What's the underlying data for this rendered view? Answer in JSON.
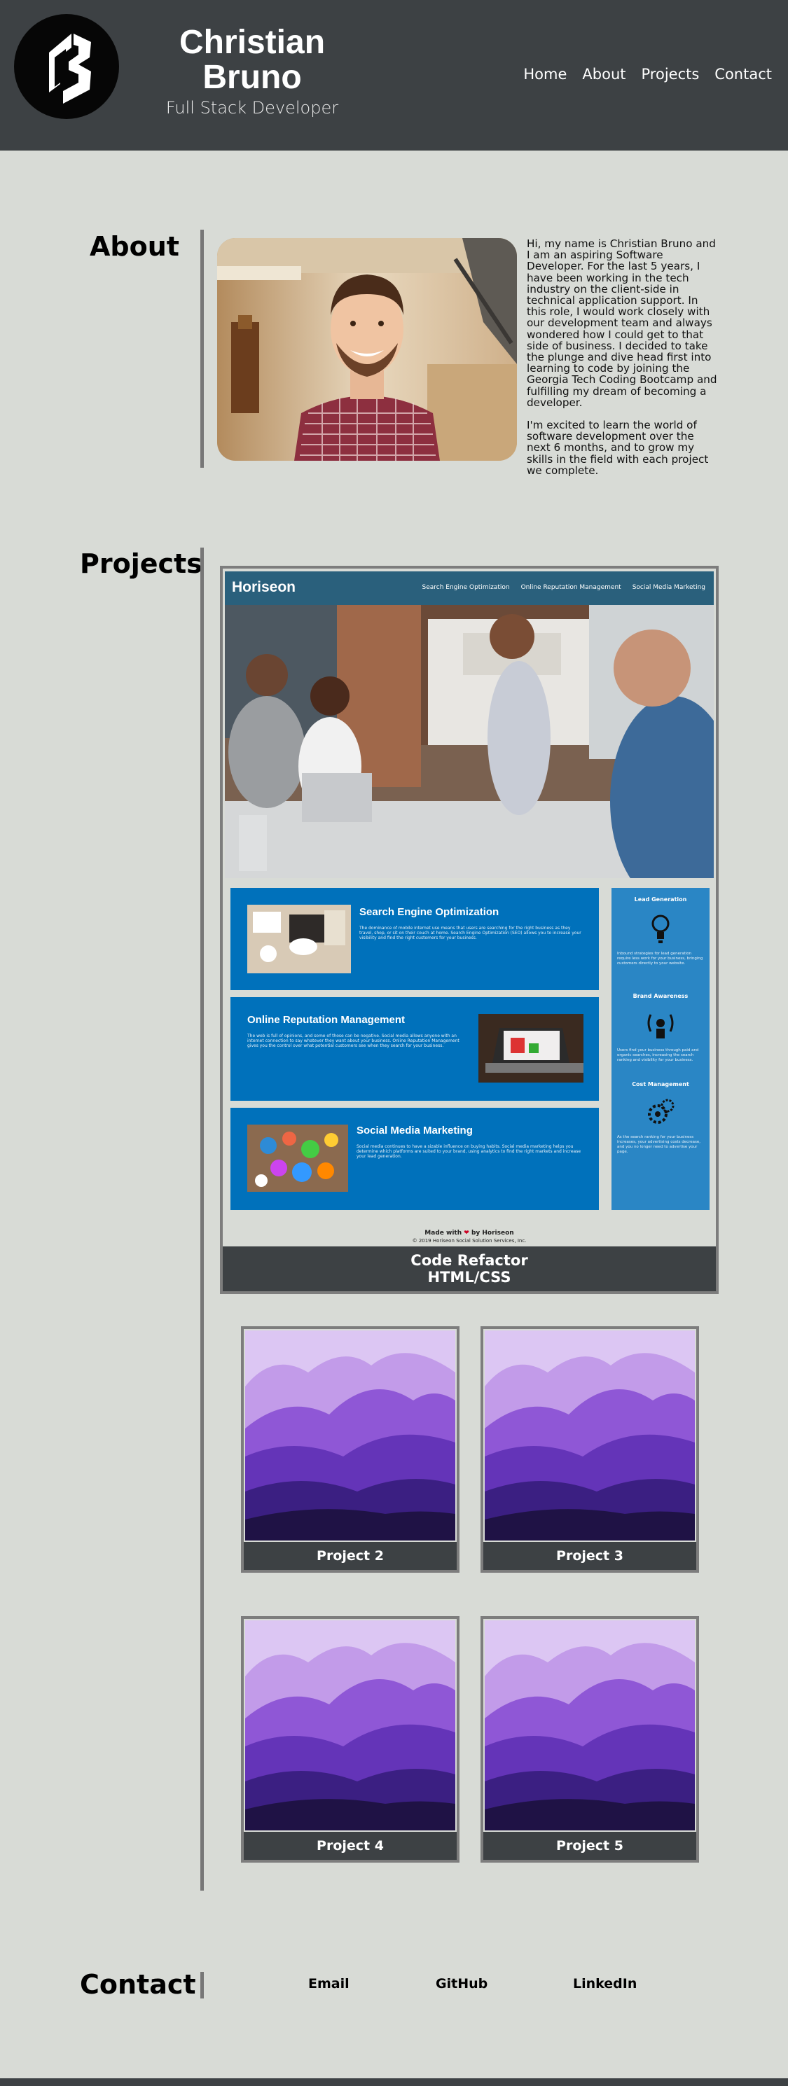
{
  "header": {
    "name_first": "Christian",
    "name_last": "Bruno",
    "subtitle": "Full Stack Developer",
    "nav": [
      "Home",
      "About",
      "Projects",
      "Contact"
    ]
  },
  "about": {
    "title": "About",
    "paragraph1": "Hi, my name is Christian Bruno and I am an aspiring Software Developer. For the last 5 years, I have been working in the tech industry on the client-side in technical application support. In this role, I would work closely with our development team and always wondered how I could get to that side of business. I decided to take the plunge and dive head first into learning to code by joining the Georgia Tech Coding Bootcamp and fulfilling my dream of becoming a developer.",
    "paragraph2": "I'm excited to learn the world of software development over the next 6 months, and to grow my skills in the field with each project we complete."
  },
  "projects": {
    "title": "Projects",
    "featured": {
      "caption_line1": "Code Refactor",
      "caption_line2": "HTML/CSS",
      "preview": {
        "logo": "Horiseon",
        "nav": [
          "Search Engine Optimization",
          "Online Reputation Management",
          "Social Media Marketing"
        ],
        "cards": [
          {
            "title": "Search Engine Optimization",
            "text": "The dominance of mobile internet use means that users are searching for the right business as they travel, shop, or sit on their couch at home. Search Engine Optimization (SEO) allows you to increase your visibility and find the right customers for your business."
          },
          {
            "title": "Online Reputation Management",
            "text": "The web is full of opinions, and some of those can be negative. Social media allows anyone with an internet connection to say whatever they want about your business. Online Reputation Management gives you the control over what potential customers see when they search for your business."
          },
          {
            "title": "Social Media Marketing",
            "text": "Social media continues to have a sizable influence on buying habits. Social media marketing helps you determine which platforms are suited to your brand, using analytics to find the right markets and increase your lead generation."
          }
        ],
        "side": [
          {
            "title": "Lead Generation",
            "text": "Inbound strategies for lead generation require less work for your business, bringing customers directly to your website."
          },
          {
            "title": "Brand Awareness",
            "text": "Users find your business through paid and organic searches, increasing the search ranking and visibility for your business."
          },
          {
            "title": "Cost Management",
            "text": "As the search ranking for your business increases, your advertising costs decrease, and you no longer need to advertise your page."
          }
        ],
        "footer_made": "Made with",
        "footer_by": "by Horiseon",
        "footer_copy": "© 2019 Horiseon Social Solution Services, Inc."
      }
    },
    "small": [
      {
        "caption": "Project 2"
      },
      {
        "caption": "Project 3"
      },
      {
        "caption": "Project 4"
      },
      {
        "caption": "Project 5"
      }
    ]
  },
  "contact": {
    "title": "Contact",
    "links": [
      "Email",
      "GitHub",
      "LinkedIn"
    ]
  },
  "icons": {
    "logo": "cb-monogram-logo",
    "heart": "heart-icon",
    "lead": "lightbulb-icon",
    "brand": "broadcast-person-icon",
    "cost": "money-gears-icon"
  },
  "colors": {
    "header_bg": "#3d4144",
    "page_bg": "#d8dbd6",
    "horiseon_blue": "#0071bb",
    "horiseon_header": "#2a607c",
    "horiseon_side": "#2a86c5"
  }
}
